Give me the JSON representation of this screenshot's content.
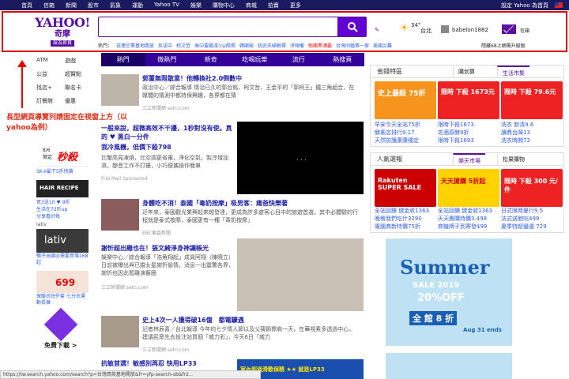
{
  "topbar": {
    "nav": [
      "首頁",
      "信箱",
      "新聞",
      "股市",
      "氣象",
      "運動",
      "Yahoo TV",
      "娛樂",
      "購物中心",
      "商城",
      "拍賣",
      "更多"
    ],
    "settings": "設定 Yahoo 為首頁"
  },
  "header": {
    "logo_text": "YAHOO!",
    "logo_sub": "奇摩",
    "logo_tag": "設為首頁",
    "trends_label": "熱門：",
    "trends": [
      "花蓮空軍基地開放",
      "反送中",
      "柯文哲",
      "高中要霸凌小p照揭",
      "韓國瑜",
      "統武夫婦解禪",
      "淨頻備",
      "他國黑鴻霸",
      "台灣同婚第一案",
      "美國災難"
    ],
    "weather_temp": "34°",
    "weather_city": "台北",
    "user": "babelon1882",
    "mail_label": "信箱",
    "mail_note": "隱藏68上網需升級版"
  },
  "left": {
    "rows": [
      [
        "ATM",
        "遊戲"
      ],
      [
        "公益",
        "超贊點"
      ],
      [
        "找店+",
        "聯名卡"
      ],
      [
        "訂餐館",
        "優惠"
      ]
    ],
    "annotation": "長型網頁導覽列請固定在視窗上方（以yahoo為例）",
    "ad_sale": "8/6 限定",
    "ad_sale_big": "秒殺",
    "ad_sale_desc": "SK-II最下5折快搶",
    "hair_title": "HAIR RECIPE",
    "hair_desc": "買3送10 ♥ 9折",
    "hair_note": "生活在72折up",
    "hair_note2": "分享看好每",
    "lativ_label": "lativ",
    "lativ_name": "lativ",
    "lativ_desc": "暢子出國必需要買場168起",
    "price_label": "699",
    "price_desc": "保暖衣短外套 七分衣運動長褲",
    "promo_text": "免費下載 >"
  },
  "tabs": [
    "熱門",
    "微熱門",
    "新奇",
    "吃喝玩樂",
    "流行",
    "熱搜頁"
  ],
  "news": [
    {
      "title": "郭董無限散業！他轉換社2.0倒數中",
      "desc": "政治中心／綜合報導 情治已久的郭台銘、柯文哲、王金平的「郭柯王」鐵三角組合，在媒體的猜測中都持保興趣，各界都在猜",
      "src": "三立新聞網 setn.com"
    },
    {
      "title": "一般來說，超微高效不干擾，1秒對沒有使。真的 ♥ 黑白一分件",
      "desc": "比蟹高見凍燒，比空調更省電，淨化空氣，製冷增加濕，靜音工作不打擾，小巧便攜操作簡單",
      "title2": "我冷風機，低價下殺798",
      "src": "Frid Mail  Sponsored"
    },
    {
      "title": "身體吃不消！泰國「毒奶按摩」吸男客：痛爸快樂著",
      "desc": "近年來，泰國觀光業興起來越發達，更成為許多遊客心目中的旅遊首選，其中必體驗的行程就是泰式按摩，泰國更有一種「毒奶按摩」",
      "src": "EBC東森新聞"
    },
    {
      "title": "謝忻超出雞也在！張文綺淨身神讓帳光",
      "desc": "娛樂中心／綜合報導「浩角翔起」成員阿翔（陳曉立）日前被曝出與已婚女星謝忻偷情，消息一出震驚各界，謝忻也因此暫離演藝圈",
      "src": "三立新聞網 setn.com"
    },
    {
      "title": "史上4次一人獲得破16億　都電驟遇",
      "desc": "記者林辰喜／台北報導 今年的七夕情人節以及父親節擦肩一天，在華視素多透過中心，建議民眾先去投注站買個「威力彩」，今天6日「威力",
      "src": "三立新聞網 setn.com"
    },
    {
      "title": "抗敏首選！敏感別再忍 快用LP33",
      "desc": "",
      "src": ""
    }
  ],
  "news_banner": "室內到過滑歡保精 ★★ 就是LP33",
  "sidebar": {
    "panel1_title": "省錢特區",
    "panel1_tab1": "購划算",
    "panel1_tab2": "生活市集",
    "promo1": "史上最殺 75折",
    "promo2": "限時 下殺 1673元",
    "promo3": "限時 下殺 79.6元",
    "links1": [
      [
        "早安今天全站75折",
        "限時下殺1673",
        "洗衣 新清9.6"
      ],
      [
        "酵素店排行9.17",
        "佐酒原酵9折",
        "讀鼎台灣13"
      ],
      [
        "天然防護康康穩定",
        "限時下殺1693",
        "洗衣時開72"
      ]
    ],
    "panel2_title": "人氣選報",
    "panel2_tab1": "樂天市場",
    "panel2_tab2": "松果購物",
    "promo4": "Rakuten SUPER SALE",
    "promo5": "天天搶購 5折起",
    "promo6": "限時 下殺 300 元/件",
    "links2": [
      [
        "全站回饋 健金收1363",
        "全站回饋 健金收1363",
        "日式限時夏行9.5"
      ],
      [
        "晚餐我們吃什3290",
        "天天團購特價3.498",
        "法式送飽吃499"
      ],
      [
        "電腦商新特價75折",
        "商機牌子到寄發$99",
        "夏季特超優選 729"
      ]
    ],
    "ad_title": "Summer",
    "ad_sub": "SALE 2019",
    "ad_off": "20%OFF",
    "ad_line": "全 館 8 折",
    "ad_date": "Aug 31 ends"
  },
  "status": "https://tw.search.yahoo.com/search?p=台灣西英基地開放&fr=yfp-search-sb&fr2..."
}
